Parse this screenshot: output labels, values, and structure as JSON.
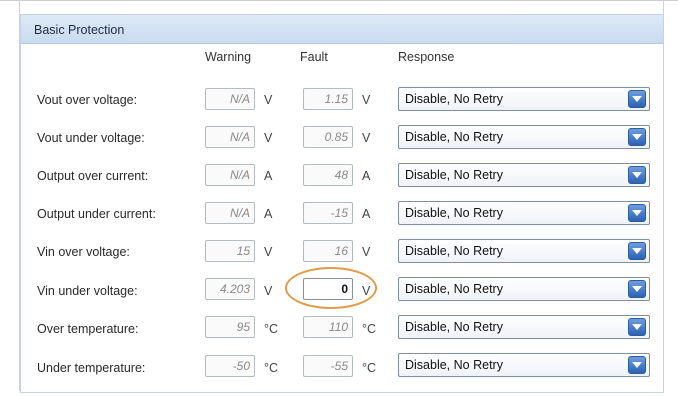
{
  "panel": {
    "title": "Basic Protection"
  },
  "columns": {
    "warning": "Warning",
    "fault": "Fault",
    "response": "Response"
  },
  "rows": [
    {
      "label": "Vout over voltage:",
      "warning": "N/A",
      "warning_unit": "V",
      "fault": "1.15",
      "fault_unit": "V",
      "response": "Disable, No Retry"
    },
    {
      "label": "Vout under voltage:",
      "warning": "N/A",
      "warning_unit": "V",
      "fault": "0.85",
      "fault_unit": "V",
      "response": "Disable, No Retry"
    },
    {
      "label": "Output over current:",
      "warning": "N/A",
      "warning_unit": "A",
      "fault": "48",
      "fault_unit": "A",
      "response": "Disable, No Retry"
    },
    {
      "label": "Output under current:",
      "warning": "N/A",
      "warning_unit": "A",
      "fault": "-15",
      "fault_unit": "A",
      "response": "Disable, No Retry"
    },
    {
      "label": "Vin over voltage:",
      "warning": "15",
      "warning_unit": "V",
      "fault": "16",
      "fault_unit": "V",
      "response": "Disable, No Retry"
    },
    {
      "label": "Vin under voltage:",
      "warning": "4.203",
      "warning_unit": "V",
      "fault": "0",
      "fault_unit": "V",
      "response": "Disable, No Retry"
    },
    {
      "label": "Over temperature:",
      "warning": "95",
      "warning_unit": "°C",
      "fault": "110",
      "fault_unit": "°C",
      "response": "Disable, No Retry"
    },
    {
      "label": "Under temperature:",
      "warning": "-50",
      "warning_unit": "°C",
      "fault": "-55",
      "fault_unit": "°C",
      "response": "Disable, No Retry"
    }
  ],
  "icons": {
    "dropdown": "chevron-down-icon"
  },
  "colors": {
    "header": "#c9dbf0",
    "dropdown_button": "#2b62b5",
    "highlight": "#e39a46"
  }
}
